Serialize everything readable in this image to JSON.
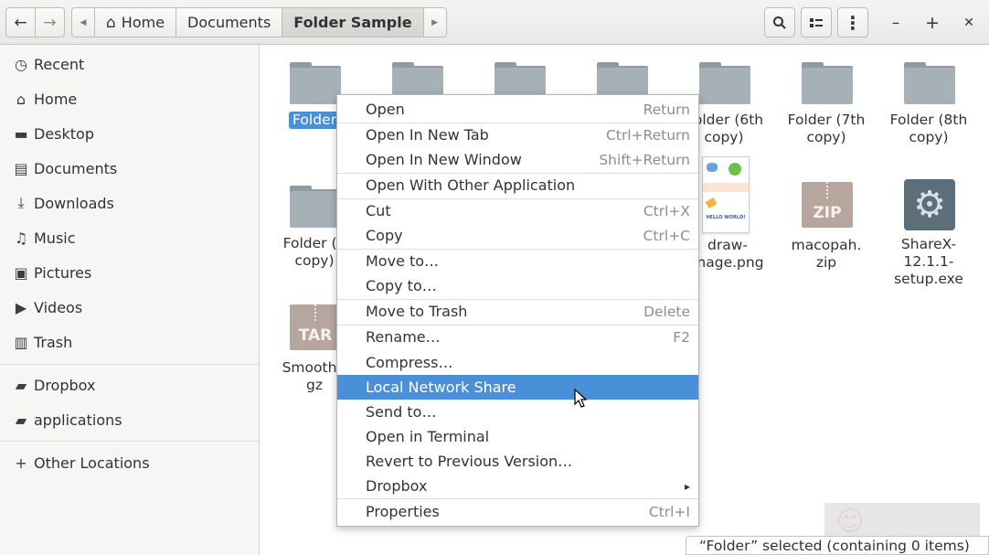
{
  "header": {
    "back_icon": "←",
    "forward_icon": "→",
    "path_prev_icon": "◀",
    "path_next_icon": "▶",
    "path": [
      "Home",
      "Documents",
      "Folder Sample"
    ],
    "home_icon": "⌂",
    "search_icon": "search-icon",
    "view_icon": "list-view-icon",
    "menu_icon": "⋮",
    "minimize": "–",
    "maximize": "+",
    "close": "✕"
  },
  "sidebar": {
    "items": [
      {
        "label": "Recent",
        "icon": "◷"
      },
      {
        "label": "Home",
        "icon": "⌂"
      },
      {
        "label": "Desktop",
        "icon": "▬"
      },
      {
        "label": "Documents",
        "icon": "▤"
      },
      {
        "label": "Downloads",
        "icon": "⤓"
      },
      {
        "label": "Music",
        "icon": "♫"
      },
      {
        "label": "Pictures",
        "icon": "▣"
      },
      {
        "label": "Videos",
        "icon": "▶"
      },
      {
        "label": "Trash",
        "icon": "▥"
      },
      {
        "label": "Dropbox",
        "icon": "▰"
      },
      {
        "label": "applications",
        "icon": "▰"
      },
      {
        "label": "Other Locations",
        "icon": "+"
      }
    ]
  },
  "files": [
    {
      "label": "Folder",
      "type": "folder",
      "selected": true
    },
    {
      "label": "",
      "type": "folder"
    },
    {
      "label": "",
      "type": "folder"
    },
    {
      "label": "",
      "type": "folder"
    },
    {
      "label": "Folder (6th copy)",
      "type": "folder"
    },
    {
      "label": "Folder (7th copy)",
      "type": "folder"
    },
    {
      "label": "Folder (8th copy)",
      "type": "folder"
    },
    {
      "label": "Folder (9th copy)",
      "type": "folder"
    },
    {
      "label": "draw-image.png",
      "type": "image"
    },
    {
      "label": "macopah.zip",
      "type": "zip",
      "badge": "ZIP"
    },
    {
      "label": "ShareX-12.1.1-setup.exe",
      "type": "exe"
    },
    {
      "label": "Smooth.tgz",
      "type": "tar",
      "badge": "TAR"
    }
  ],
  "file_labels_visible": {
    "folder": "Folder",
    "f6": [
      "older (6th",
      "copy)"
    ],
    "f7": [
      "Folder (7th",
      "copy)"
    ],
    "f8": [
      "Folder (8th",
      "copy)"
    ],
    "f9": [
      "Folder (9",
      "copy)"
    ],
    "draw": [
      "draw-",
      "nage.png"
    ],
    "zip": [
      "macopah.",
      "zip"
    ],
    "exe": [
      "ShareX-",
      "12.1.1-",
      "setup.exe"
    ],
    "tar": [
      "Smooth.t",
      "gz"
    ]
  },
  "image_thumb_text": "HELLO WORLD!",
  "context_menu": [
    {
      "label": "Open",
      "accel": "Return"
    },
    {
      "label": "Open In New Tab",
      "accel": "Ctrl+Return"
    },
    {
      "label": "Open In New Window",
      "accel": "Shift+Return"
    },
    {
      "label": "Open With Other Application",
      "accel": ""
    },
    {
      "label": "Cut",
      "accel": "Ctrl+X"
    },
    {
      "label": "Copy",
      "accel": "Ctrl+C"
    },
    {
      "label": "Move to…",
      "accel": ""
    },
    {
      "label": "Copy to…",
      "accel": ""
    },
    {
      "label": "Move to Trash",
      "accel": "Delete"
    },
    {
      "label": "Rename…",
      "accel": "F2"
    },
    {
      "label": "Compress…",
      "accel": ""
    },
    {
      "label": "Local Network Share",
      "accel": "",
      "active": true
    },
    {
      "label": "Send to…",
      "accel": ""
    },
    {
      "label": "Open in Terminal",
      "accel": ""
    },
    {
      "label": "Revert to Previous Version…",
      "accel": ""
    },
    {
      "label": "Dropbox",
      "accel": "▸"
    },
    {
      "label": "Properties",
      "accel": "Ctrl+I"
    }
  ],
  "status": "“Folder” selected (containing 0 items)",
  "colors": {
    "selection": "#4a90d9",
    "folder": "#a5b1b6"
  }
}
